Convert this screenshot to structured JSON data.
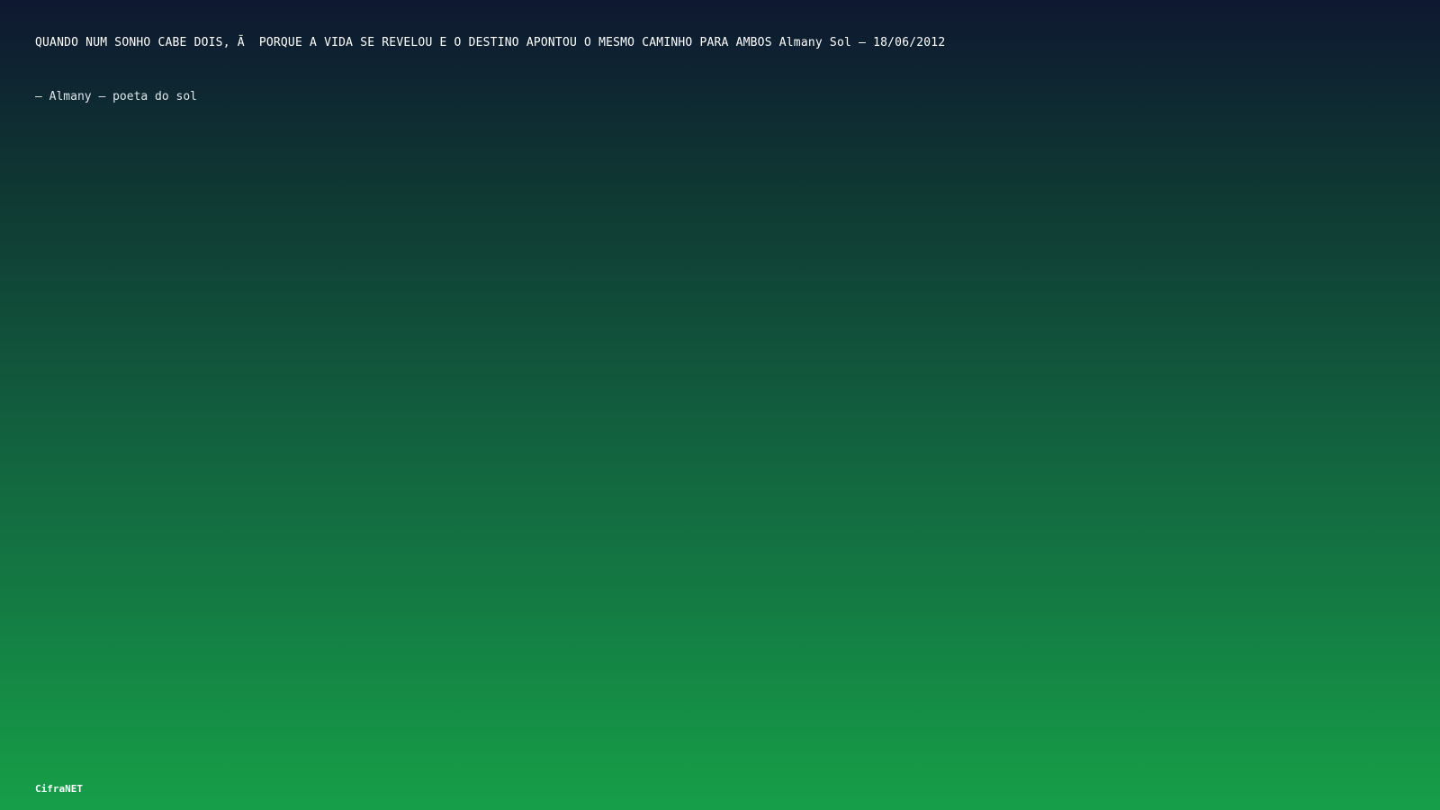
{
  "quote": {
    "text": "QUANDO NUM SONHO CABE DOIS, Ã  PORQUE A VIDA SE REVELOU E O DESTINO APONTOU O MESMO CAMINHO PARA AMBOS Almany Sol – 18/06/2012"
  },
  "attribution": {
    "text": "– Almany – poeta do sol"
  },
  "brand": {
    "text": "CifraNET"
  },
  "colors": {
    "gradient_top": "#0e1830",
    "gradient_bottom": "#169f48",
    "text": "#ffffff"
  }
}
